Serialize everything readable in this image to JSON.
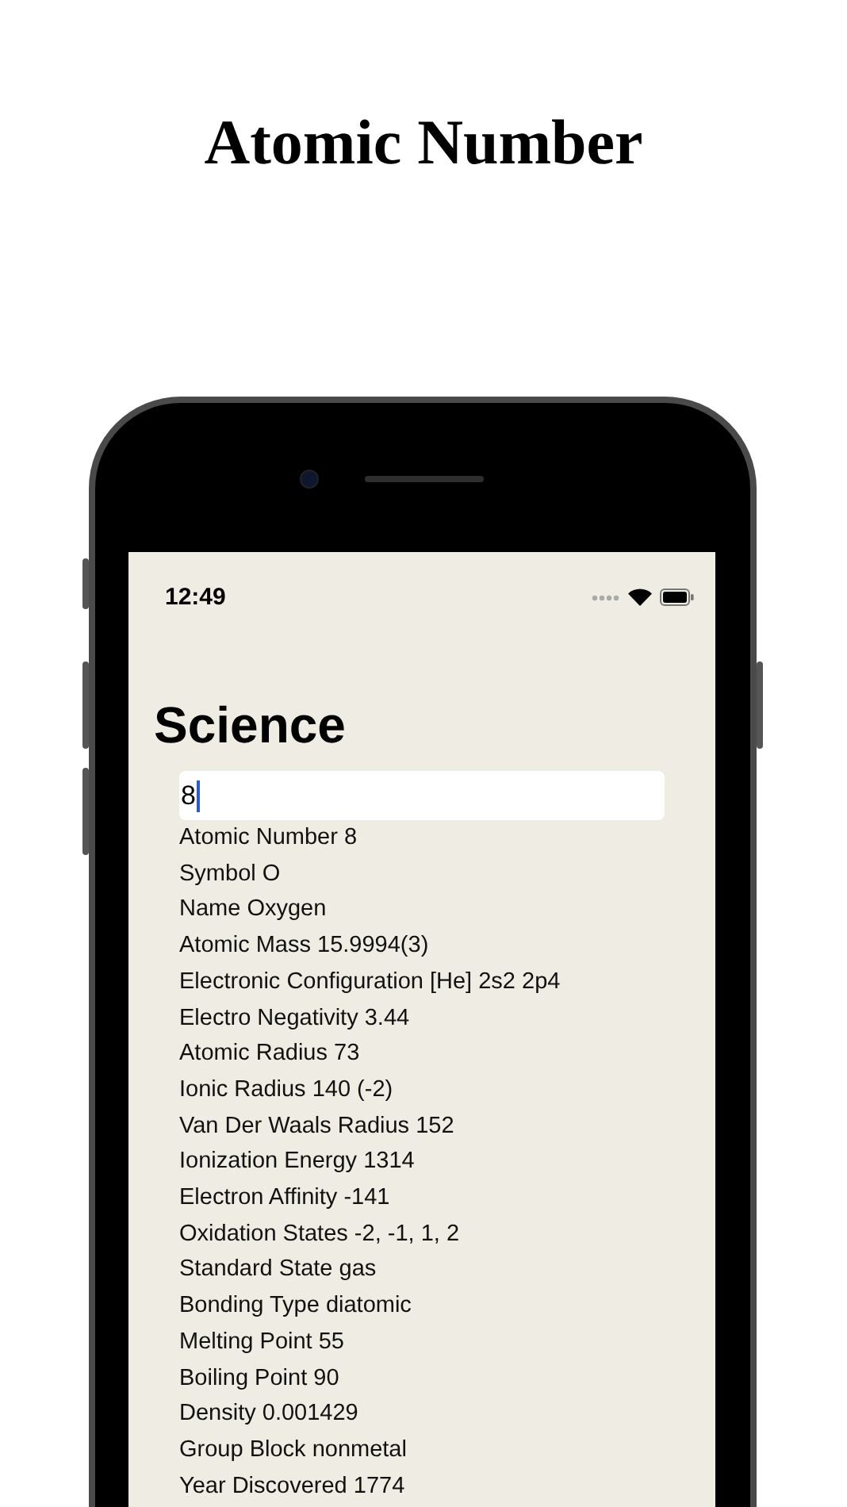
{
  "headline": "Atomic Number",
  "phone": {
    "status_bar": {
      "time": "12:49"
    },
    "title": "Science",
    "search": {
      "value": "8"
    },
    "details": [
      "Atomic Number 8",
      "Symbol O",
      "Name Oxygen",
      "Atomic Mass 15.9994(3)",
      "Electronic Configuration [He] 2s2 2p4",
      "Electro Negativity 3.44",
      "Atomic Radius 73",
      "Ionic Radius 140 (-2)",
      "Van Der Waals Radius 152",
      "Ionization Energy 1314",
      "Electron Affinity -141",
      "Oxidation States -2, -1, 1, 2",
      "Standard State gas",
      "Bonding Type diatomic",
      "Melting Point 55",
      "Boiling Point 90",
      "Density 0.001429",
      "Group Block nonmetal",
      "Year Discovered 1774"
    ]
  }
}
